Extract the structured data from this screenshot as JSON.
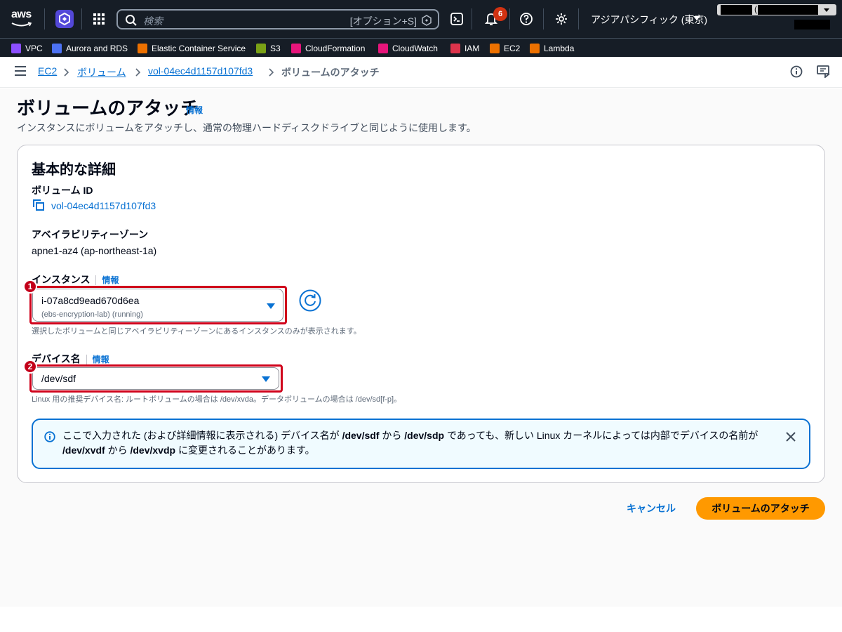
{
  "topbar": {
    "logo": "aws",
    "search_placeholder": "検索",
    "search_shortcut": "[オプション+S]",
    "notification_count": "6",
    "region": "アジアパシフィック (東京)",
    "account_masked_paren": "("
  },
  "favorites": [
    {
      "label": "VPC",
      "icon": "vpc-icon",
      "color": "#8c4fff"
    },
    {
      "label": "Aurora and RDS",
      "icon": "rds-icon",
      "color": "#4d72f3"
    },
    {
      "label": "Elastic Container Service",
      "icon": "ecs-icon",
      "color": "#ed7100"
    },
    {
      "label": "S3",
      "icon": "s3-icon",
      "color": "#7aa116"
    },
    {
      "label": "CloudFormation",
      "icon": "cloudformation-icon",
      "color": "#e7157b"
    },
    {
      "label": "CloudWatch",
      "icon": "cloudwatch-icon",
      "color": "#e7157b"
    },
    {
      "label": "IAM",
      "icon": "iam-icon",
      "color": "#dd344c"
    },
    {
      "label": "EC2",
      "icon": "ec2-icon",
      "color": "#ed7100"
    },
    {
      "label": "Lambda",
      "icon": "lambda-icon",
      "color": "#ed7100"
    }
  ],
  "breadcrumb": {
    "items": [
      "EC2",
      "ボリューム",
      "vol-04ec4d1157d107fd3"
    ],
    "current": "ボリュームのアタッチ"
  },
  "page": {
    "title": "ボリュームのアタッチ",
    "info": "情報",
    "description": "インスタンスにボリュームをアタッチし、通常の物理ハードディスクドライブと同じように使用します。"
  },
  "card": {
    "title": "基本的な詳細",
    "volume_id_label": "ボリューム ID",
    "volume_id": "vol-04ec4d1157d107fd3",
    "az_label": "アベイラビリティーゾーン",
    "az_value": "apne1-az4 (ap-northeast-1a)",
    "instance_label": "インスタンス",
    "instance_info": "情報",
    "instance_value": "i-07a8cd9ead670d6ea",
    "instance_sub": "(ebs-encryption-lab) (running)",
    "instance_hint": "選択したボリュームと同じアベイラビリティーゾーンにあるインスタンスのみが表示されます。",
    "device_label": "デバイス名",
    "device_info": "情報",
    "device_value": "/dev/sdf",
    "device_hint": "Linux 用の推奨デバイス名: ルートボリュームの場合は /dev/xvda。データボリュームの場合は /dev/sd[f-p]。",
    "callout_1": "1",
    "callout_2": "2"
  },
  "alert": {
    "t1": "ここで入力された (および詳細情報に表示される) デバイス名が ",
    "b1": "/dev/sdf",
    "t2": " から ",
    "b2": "/dev/sdp",
    "t3": " であっても、新しい Linux カーネルによっては内部でデバイスの名前が ",
    "b3": "/dev/xvdf",
    "t4": " から ",
    "b4": "/dev/xvdp",
    "t5": " に変更されることがあります。"
  },
  "actions": {
    "cancel": "キャンセル",
    "attach": "ボリュームのアタッチ"
  },
  "colors": {
    "topbar": "#161d26",
    "link": "#0972d3",
    "primary_button": "#ff9900",
    "highlight": "#d0021b",
    "notification_badge": "#d13212"
  }
}
